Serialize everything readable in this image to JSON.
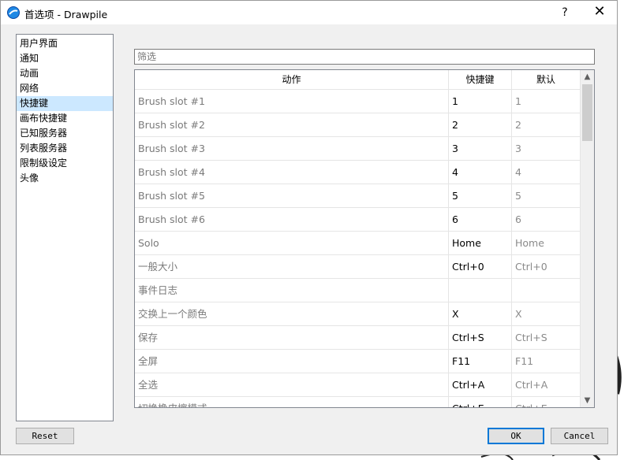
{
  "window": {
    "title": "首选项 - Drawpile",
    "help_label": "?",
    "close_label": "✕"
  },
  "sidebar": {
    "items": [
      {
        "label": "用户界面",
        "active": false
      },
      {
        "label": "通知",
        "active": false
      },
      {
        "label": "动画",
        "active": false
      },
      {
        "label": "网络",
        "active": false
      },
      {
        "label": "快捷键",
        "active": true
      },
      {
        "label": "画布快捷键",
        "active": false
      },
      {
        "label": "已知服务器",
        "active": false
      },
      {
        "label": "列表服务器",
        "active": false
      },
      {
        "label": "限制级设定",
        "active": false
      },
      {
        "label": "头像",
        "active": false
      }
    ]
  },
  "filter": {
    "placeholder": "筛选",
    "value": ""
  },
  "table": {
    "headers": {
      "action": "动作",
      "shortcut": "快捷键",
      "default": "默认"
    },
    "rows": [
      {
        "action": "Brush slot #1",
        "shortcut": "1",
        "default": "1"
      },
      {
        "action": "Brush slot #2",
        "shortcut": "2",
        "default": "2"
      },
      {
        "action": "Brush slot #3",
        "shortcut": "3",
        "default": "3"
      },
      {
        "action": "Brush slot #4",
        "shortcut": "4",
        "default": "4"
      },
      {
        "action": "Brush slot #5",
        "shortcut": "5",
        "default": "5"
      },
      {
        "action": "Brush slot #6",
        "shortcut": "6",
        "default": "6"
      },
      {
        "action": "Solo",
        "shortcut": "Home",
        "default": "Home"
      },
      {
        "action": "一般大小",
        "shortcut": "Ctrl+0",
        "default": "Ctrl+0"
      },
      {
        "action": "事件日志",
        "shortcut": "",
        "default": ""
      },
      {
        "action": "交换上一个颜色",
        "shortcut": "X",
        "default": "X"
      },
      {
        "action": "保存",
        "shortcut": "Ctrl+S",
        "default": "Ctrl+S"
      },
      {
        "action": "全屏",
        "shortcut": "F11",
        "default": "F11"
      },
      {
        "action": "全选",
        "shortcut": "Ctrl+A",
        "default": "Ctrl+A"
      },
      {
        "action": "切换橡皮擦模式",
        "shortcut": "Ctrl+E",
        "default": "Ctrl+E"
      }
    ]
  },
  "buttons": {
    "reset": "Reset",
    "ok": "OK",
    "cancel": "Cancel"
  },
  "colors": {
    "selection": "#cce8ff",
    "primary_border": "#0078d7",
    "dialog_bg": "#f0f0f0"
  }
}
